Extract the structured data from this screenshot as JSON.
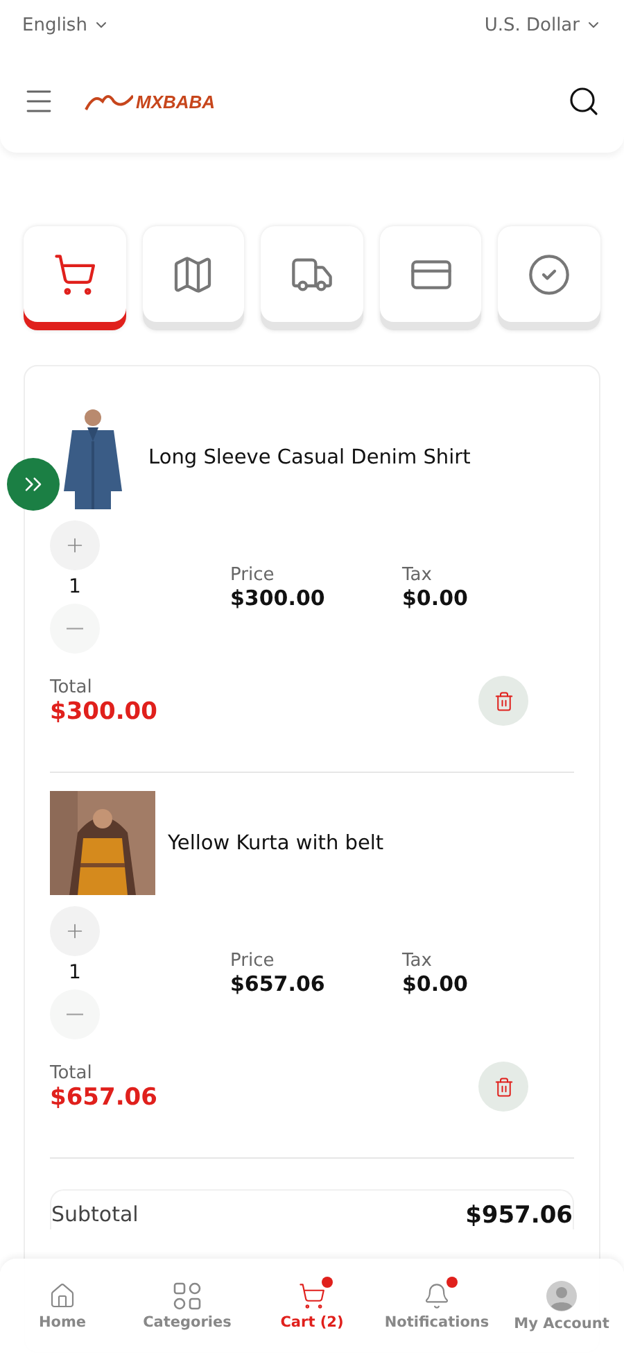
{
  "top_bar": {
    "language": "English",
    "currency": "U.S. Dollar"
  },
  "header": {
    "logo": "MXBABA"
  },
  "steps": [
    {
      "kind": "cart",
      "selected": true
    },
    {
      "kind": "map",
      "selected": false
    },
    {
      "kind": "truck",
      "selected": false
    },
    {
      "kind": "card",
      "selected": false
    },
    {
      "kind": "check",
      "selected": false
    }
  ],
  "items": [
    {
      "name": "Long Sleeve Casual Denim Shirt",
      "quantity": "1",
      "price_label": "Price",
      "price": "$300.00",
      "tax_label": "Tax",
      "tax": "$0.00",
      "total_label": "Total",
      "total": "$300.00"
    },
    {
      "name": "Yellow Kurta with belt",
      "quantity": "1",
      "price_label": "Price",
      "price": "$657.06",
      "tax_label": "Tax",
      "tax": "$0.00",
      "total_label": "Total",
      "total": "$657.06"
    }
  ],
  "summary": {
    "label": "Subtotal",
    "value": "$957.06"
  },
  "nav": [
    {
      "label": "Home",
      "selected": false,
      "badge": false
    },
    {
      "label": "Categories",
      "selected": false,
      "badge": false
    },
    {
      "label": "Cart (2)",
      "selected": true,
      "badge": true
    },
    {
      "label": "Notifications",
      "selected": false,
      "badge": true
    },
    {
      "label": "My Account",
      "selected": false,
      "badge": false
    }
  ]
}
